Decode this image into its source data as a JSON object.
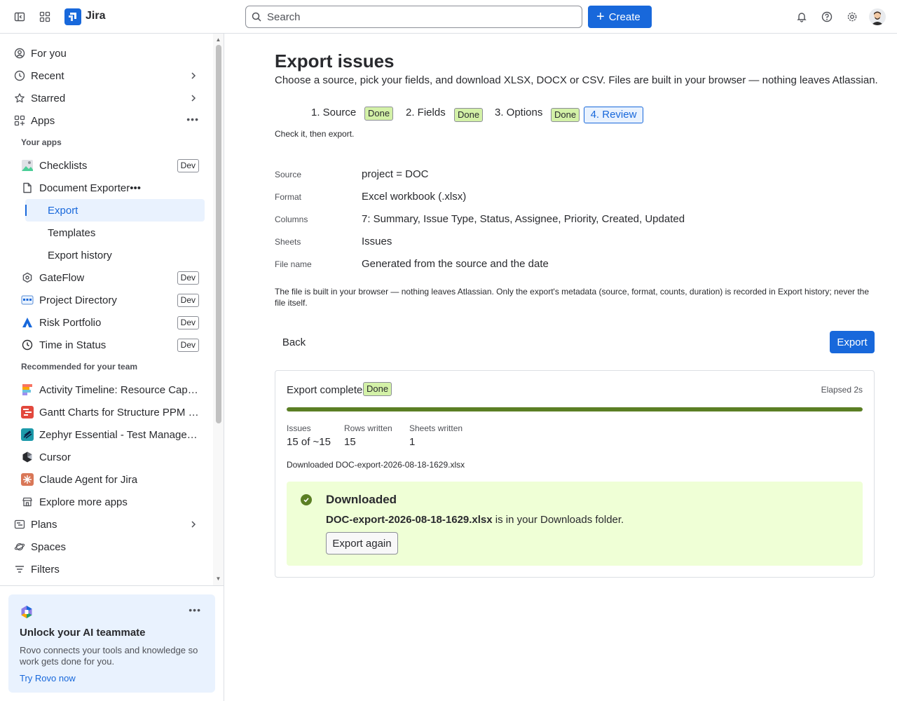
{
  "topbar": {
    "app_name": "Jira",
    "search_placeholder": "Search",
    "create_label": "Create",
    "icons": [
      "sidebar-toggle-icon",
      "app-switcher-icon",
      "notifications-icon",
      "help-icon",
      "settings-icon"
    ]
  },
  "sidebar": {
    "for_you": "For you",
    "recent": "Recent",
    "starred": "Starred",
    "apps": "Apps",
    "your_apps_label": "Your apps",
    "your_apps": [
      {
        "label": "Checklists",
        "badge": "Dev"
      },
      {
        "label": "Document Exporter"
      },
      {
        "label": "GateFlow",
        "badge": "Dev"
      },
      {
        "label": "Project Directory",
        "badge": "Dev"
      },
      {
        "label": "Risk Portfolio",
        "badge": "Dev"
      },
      {
        "label": "Time in Status",
        "badge": "Dev"
      }
    ],
    "exporter_sub": [
      "Export",
      "Templates",
      "Export history"
    ],
    "recommended_label": "Recommended for your team",
    "recommended": [
      "Activity Timeline: Resource Capacity Planning",
      "Gantt Charts for Structure PPM - Timeline",
      "Zephyr Essential - Test Management",
      "Cursor",
      "Claude Agent for Jira",
      "Explore more apps"
    ],
    "plans": "Plans",
    "spaces": "Spaces",
    "filters": "Filters"
  },
  "rovo": {
    "title": "Unlock your AI teammate",
    "text": "Rovo connects your tools and knowledge so work gets done for you.",
    "link": "Try Rovo now"
  },
  "main": {
    "title": "Export issues",
    "description": "Choose a source, pick your fields, and download XLSX, DOCX or CSV. Files are built in your browser — nothing leaves Atlassian.",
    "steps": [
      {
        "label": "1. Source",
        "status": "Done"
      },
      {
        "label": "2. Fields",
        "status": "Done"
      },
      {
        "label": "3. Options",
        "status": "Done"
      },
      {
        "label": "4. Review"
      }
    ],
    "step_hint": "Check it, then export.",
    "summary": [
      {
        "label": "Source",
        "value": "project = DOC"
      },
      {
        "label": "Format",
        "value": "Excel workbook (.xlsx)"
      },
      {
        "label": "Columns",
        "value": "7: Summary, Issue Type, Status, Assignee, Priority, Created, Updated"
      },
      {
        "label": "Sheets",
        "value": "Issues"
      },
      {
        "label": "File name",
        "value": "Generated from the source and the date"
      }
    ],
    "note": "The file is built in your browser — nothing leaves Atlassian. Only the export's metadata (source, format, counts, duration) is recorded in Export history; never the file itself.",
    "back_label": "Back",
    "export_label": "Export"
  },
  "result": {
    "title": "Export complete",
    "status": "Done",
    "elapsed": "Elapsed 2s",
    "progress": 1.0,
    "progress_color": "#5b7f24",
    "stats": [
      {
        "label": "Issues",
        "value": "15 of ~15"
      },
      {
        "label": "Rows written",
        "value": "15"
      },
      {
        "label": "Sheets written",
        "value": "1"
      }
    ],
    "downloaded_line": "Downloaded DOC-export-2026-08-18-1629.xlsx",
    "success_title": "Downloaded",
    "file_name": "DOC-export-2026-08-18-1629.xlsx",
    "success_suffix": " is in your Downloads folder.",
    "again_label": "Export again"
  }
}
